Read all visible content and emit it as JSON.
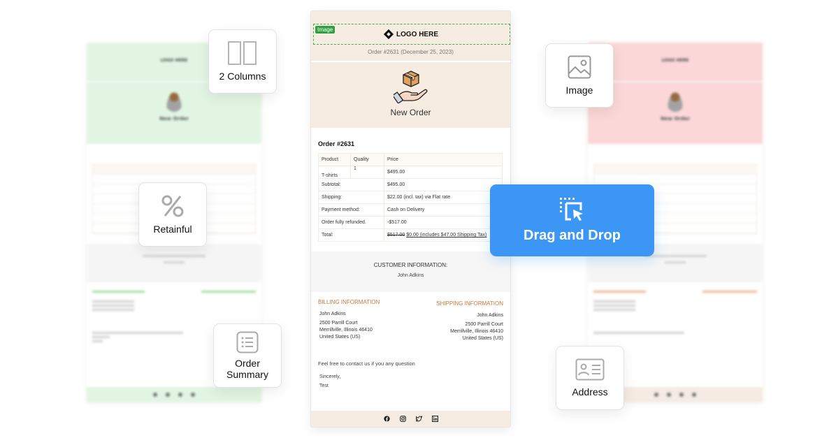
{
  "email": {
    "image_tag": "Image",
    "logo_text": "LOGO HERE",
    "order_date": "Order #2631 (December 25, 2023)",
    "hero_title": "New Order",
    "order_heading": "Order #2631",
    "table": {
      "headers": [
        "Product",
        "Quality",
        "Price"
      ],
      "item": {
        "product": "T-shirts",
        "quantity": "1",
        "price": "$495.00"
      },
      "rows": [
        {
          "label": "Subtotal:",
          "value": "$495.00"
        },
        {
          "label": "Shipping:",
          "value": "$22.00 (incl. tax) via Flat rate"
        },
        {
          "label": "Payment method:",
          "value": "Cash on Delivery"
        },
        {
          "label": "Order fully refunded.",
          "value": "-$517.00"
        }
      ],
      "total": {
        "label": "Total:",
        "old_value": "$517.00",
        "new_value": "$0.00 (includes $47.00 Shipping Tax)"
      }
    },
    "customer": {
      "label": "CUSTOMER INFORMATION:",
      "name": "John Adkins"
    },
    "billing": {
      "heading": "BILLING INFORMATION",
      "name": "John Adkins",
      "lines": [
        "2500 Parrill Court",
        "Merrillville, Illinois 46410",
        "United States (US)"
      ]
    },
    "shipping": {
      "heading": "SHIPPING INFORMATION",
      "name": "John Adkins",
      "lines": [
        "2500 Parrill Court",
        "Merrillville, Illinois 46410",
        "United States (US)"
      ]
    },
    "contact_text": "Feel free to contact us if you any question",
    "signoff": "Sincerely,",
    "signature": "Test",
    "social_icons": [
      "facebook-icon",
      "instagram-icon",
      "twitter-icon",
      "linkedin-icon"
    ]
  },
  "widgets": {
    "columns": "2 Columns",
    "retainful": "Retainful",
    "order_summary_line1": "Order",
    "order_summary_line2": "Summary",
    "image": "Image",
    "address": "Address",
    "drag_drop": "Drag and Drop"
  },
  "background_templates": {
    "left": {
      "theme_color": "#dff5df",
      "accent": "#7fcf7f",
      "title": "New Order",
      "logo_text": "LOGO HERE"
    },
    "right": {
      "theme_color": "#fbd3d3",
      "accent": "#e09a6a",
      "title": "New Order",
      "logo_text": "LOGO HERE"
    }
  },
  "colors": {
    "email_header_bg": "#f6ece2",
    "accent_orange": "#c8773c",
    "drag_drop_blue": "#3c96f6",
    "image_tag_green": "#2ea043"
  }
}
